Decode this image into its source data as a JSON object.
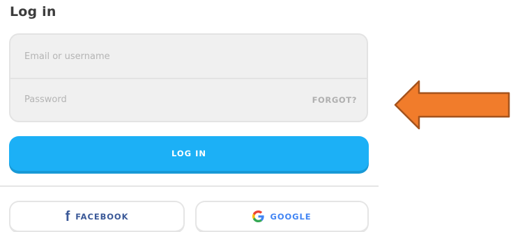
{
  "page": {
    "title": "Log in"
  },
  "form": {
    "email": {
      "placeholder": "Email or username",
      "value": ""
    },
    "password": {
      "placeholder": "Password",
      "value": ""
    },
    "forgot_label": "FORGOT?"
  },
  "actions": {
    "login_label": "LOG IN"
  },
  "social": {
    "facebook_label": "FACEBOOK",
    "facebook_icon": "facebook-icon",
    "google_label": "GOOGLE",
    "google_icon": "google-icon"
  },
  "annotation": {
    "icon": "arrow-left-icon",
    "color": "#f17c2b"
  },
  "colors": {
    "primary": "#1cb0f6",
    "facebook": "#3b5998",
    "google": "#4285f4"
  }
}
